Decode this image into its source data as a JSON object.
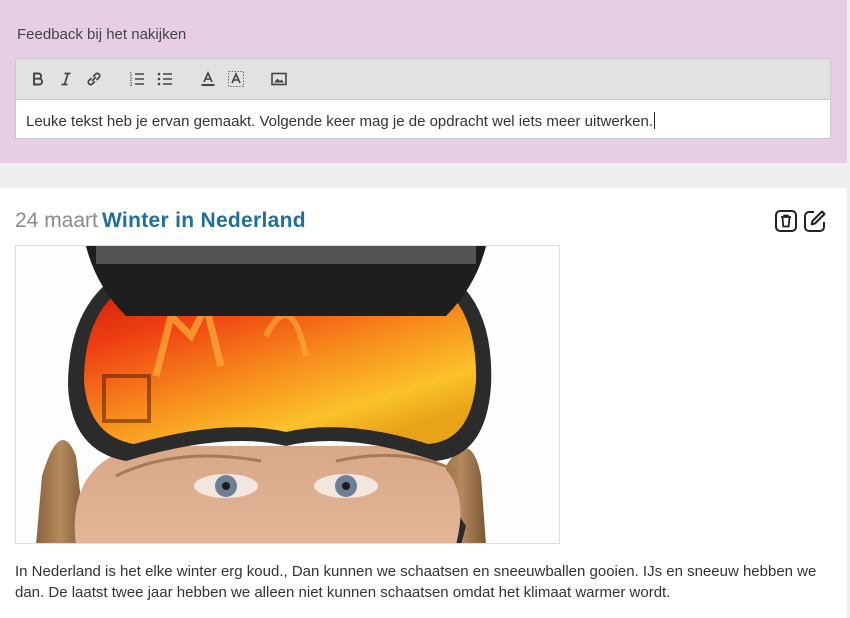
{
  "feedback": {
    "label": "Feedback bij het nakijken",
    "text": "Leuke tekst heb je ervan gemaakt. Volgende keer mag je de opdracht wel iets meer uitwerken."
  },
  "toolbar": {
    "buttons": [
      "bold-icon",
      "italic-icon",
      "link-icon",
      "ordered-list-icon",
      "bullet-list-icon",
      "text-color-icon",
      "highlight-icon",
      "image-icon"
    ]
  },
  "post": {
    "date": "24 maart",
    "title": "Winter in Nederland",
    "body": "In Nederland is het elke winter erg koud., Dan kunnen we schaatsen en sneeuwballen gooien. IJs en sneeuw hebben we dan. De laatst twee jaar hebben we alleen niet kunnen schaatsen omdat het klimaat warmer wordt.",
    "actions": [
      "delete-icon",
      "edit-icon"
    ]
  },
  "colors": {
    "feedback_bg": "#e6cfe6",
    "title": "#1f6e9c",
    "date": "#8a8a8a"
  }
}
